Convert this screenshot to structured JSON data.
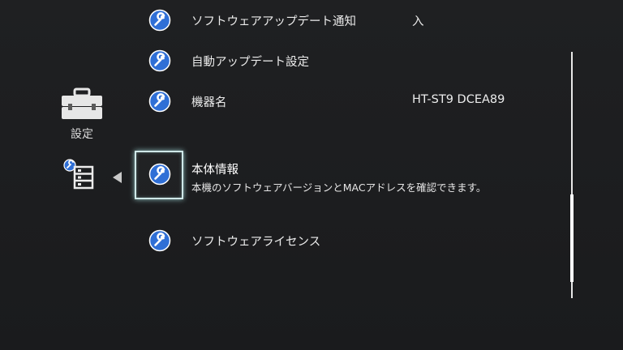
{
  "category": {
    "label": "設定",
    "icon": "toolbox-icon",
    "sub_icon": "system-list-icon"
  },
  "menu": {
    "items": [
      {
        "label": "ソフトウェアアップデート通知",
        "value": "入",
        "icon": "wrench-icon"
      },
      {
        "label": "自動アップデート設定",
        "value": "",
        "icon": "wrench-icon"
      },
      {
        "label": "機器名",
        "value": "HT-ST9 DCEA89",
        "icon": "wrench-icon"
      },
      {
        "label": "本体情報",
        "value": "",
        "icon": "wrench-icon",
        "description": "本機のソフトウェアバージョンとMACアドレスを確認できます。",
        "selected": true
      },
      {
        "label": "ソフトウェアライセンス",
        "value": "",
        "icon": "wrench-icon"
      }
    ]
  },
  "scrollbar": {
    "position_fraction": 0.58
  },
  "colors": {
    "background": "#1b1c1e",
    "icon_blue": "#2f6fd6",
    "focus": "#cfe8e8"
  }
}
